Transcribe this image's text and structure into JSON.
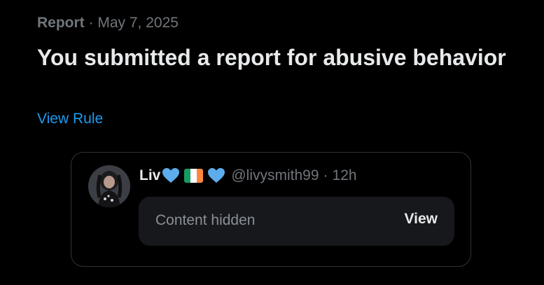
{
  "notification": {
    "type": "Report",
    "separator": "·",
    "date": "May 7, 2025",
    "title": "You submitted a report for abusive behavior",
    "link_label": "View Rule"
  },
  "post": {
    "author_name": "Liv",
    "emoji": [
      "blue-heart-icon",
      "ireland-flag-icon",
      "blue-heart-icon"
    ],
    "handle": "@livysmith99",
    "separator": "·",
    "time": "12h",
    "hidden_label": "Content hidden",
    "view_label": "View"
  },
  "colors": {
    "background": "#000000",
    "text": "#e7e9ea",
    "muted": "#71767b",
    "link": "#1d9bf0",
    "border": "#2f3336",
    "hidden_box": "#16181c",
    "heart": "#5dadec"
  }
}
